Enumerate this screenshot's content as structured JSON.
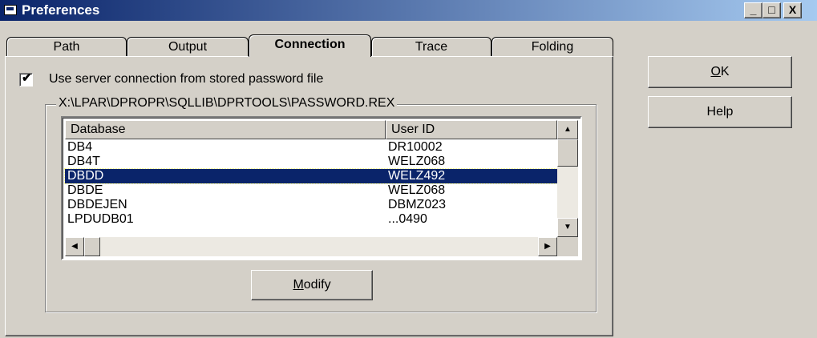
{
  "window": {
    "title": "Preferences",
    "min_glyph": "_",
    "max_glyph": "□",
    "close_glyph": "X",
    "title_icon": "app-window-icon"
  },
  "tabs": [
    {
      "label": "Path",
      "active": false
    },
    {
      "label": "Output",
      "active": false
    },
    {
      "label": "Connection",
      "active": true
    },
    {
      "label": "Trace",
      "active": false
    },
    {
      "label": "Folding",
      "active": false
    }
  ],
  "connection": {
    "use_stored_label": "Use server connection from stored password file",
    "use_stored_checked": true,
    "check_glyph": "✔",
    "group_title": "X:\\LPAR\\DPROPR\\SQLLIB\\DPRTOOLS\\PASSWORD.REX",
    "columns": [
      "Database",
      "User ID"
    ],
    "rows": [
      {
        "database": "DB4",
        "user_id": "DR10002",
        "selected": false
      },
      {
        "database": "DB4T",
        "user_id": "WELZ068",
        "selected": false
      },
      {
        "database": "DBDD",
        "user_id": "WELZ492",
        "selected": true
      },
      {
        "database": "DBDE",
        "user_id": "WELZ068",
        "selected": false
      },
      {
        "database": "DBDEJEN",
        "user_id": "DBMZ023",
        "selected": false
      },
      {
        "database": "LPDUDB01",
        "user_id": "...0490",
        "selected": false
      }
    ],
    "scroll_up_glyph": "▲",
    "scroll_down_glyph": "▼",
    "scroll_left_glyph": "◀",
    "scroll_right_glyph": "▶",
    "modify_label": {
      "mnemonic": "M",
      "rest": "odify"
    }
  },
  "buttons": {
    "ok": {
      "mnemonic": "O",
      "rest": "K"
    },
    "help": "Help"
  }
}
